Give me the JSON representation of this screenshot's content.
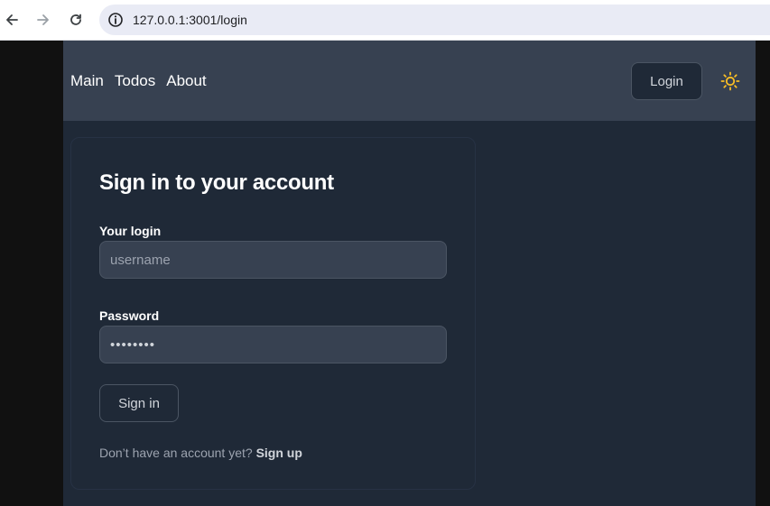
{
  "browser": {
    "url": "127.0.0.1:3001/login",
    "back_icon": "arrow-left-icon",
    "forward_icon": "arrow-right-icon",
    "reload_icon": "reload-icon",
    "site_info_icon": "info-circle-icon"
  },
  "navbar": {
    "links": [
      "Main",
      "Todos",
      "About"
    ],
    "login_label": "Login",
    "theme_icon": "sun-icon",
    "theme_icon_color": "#fbbf24"
  },
  "form": {
    "title": "Sign in to your account",
    "login_label": "Your login",
    "login_placeholder": "username",
    "login_value": "",
    "password_label": "Password",
    "password_value": "••••••••",
    "submit_label": "Sign in",
    "signup_prompt": "Don’t have an account yet?",
    "signup_link": "Sign up"
  },
  "colors": {
    "page_bg": "#1f2937",
    "navbar_bg": "#374151",
    "input_bg": "#374151",
    "border": "#4b5563"
  }
}
